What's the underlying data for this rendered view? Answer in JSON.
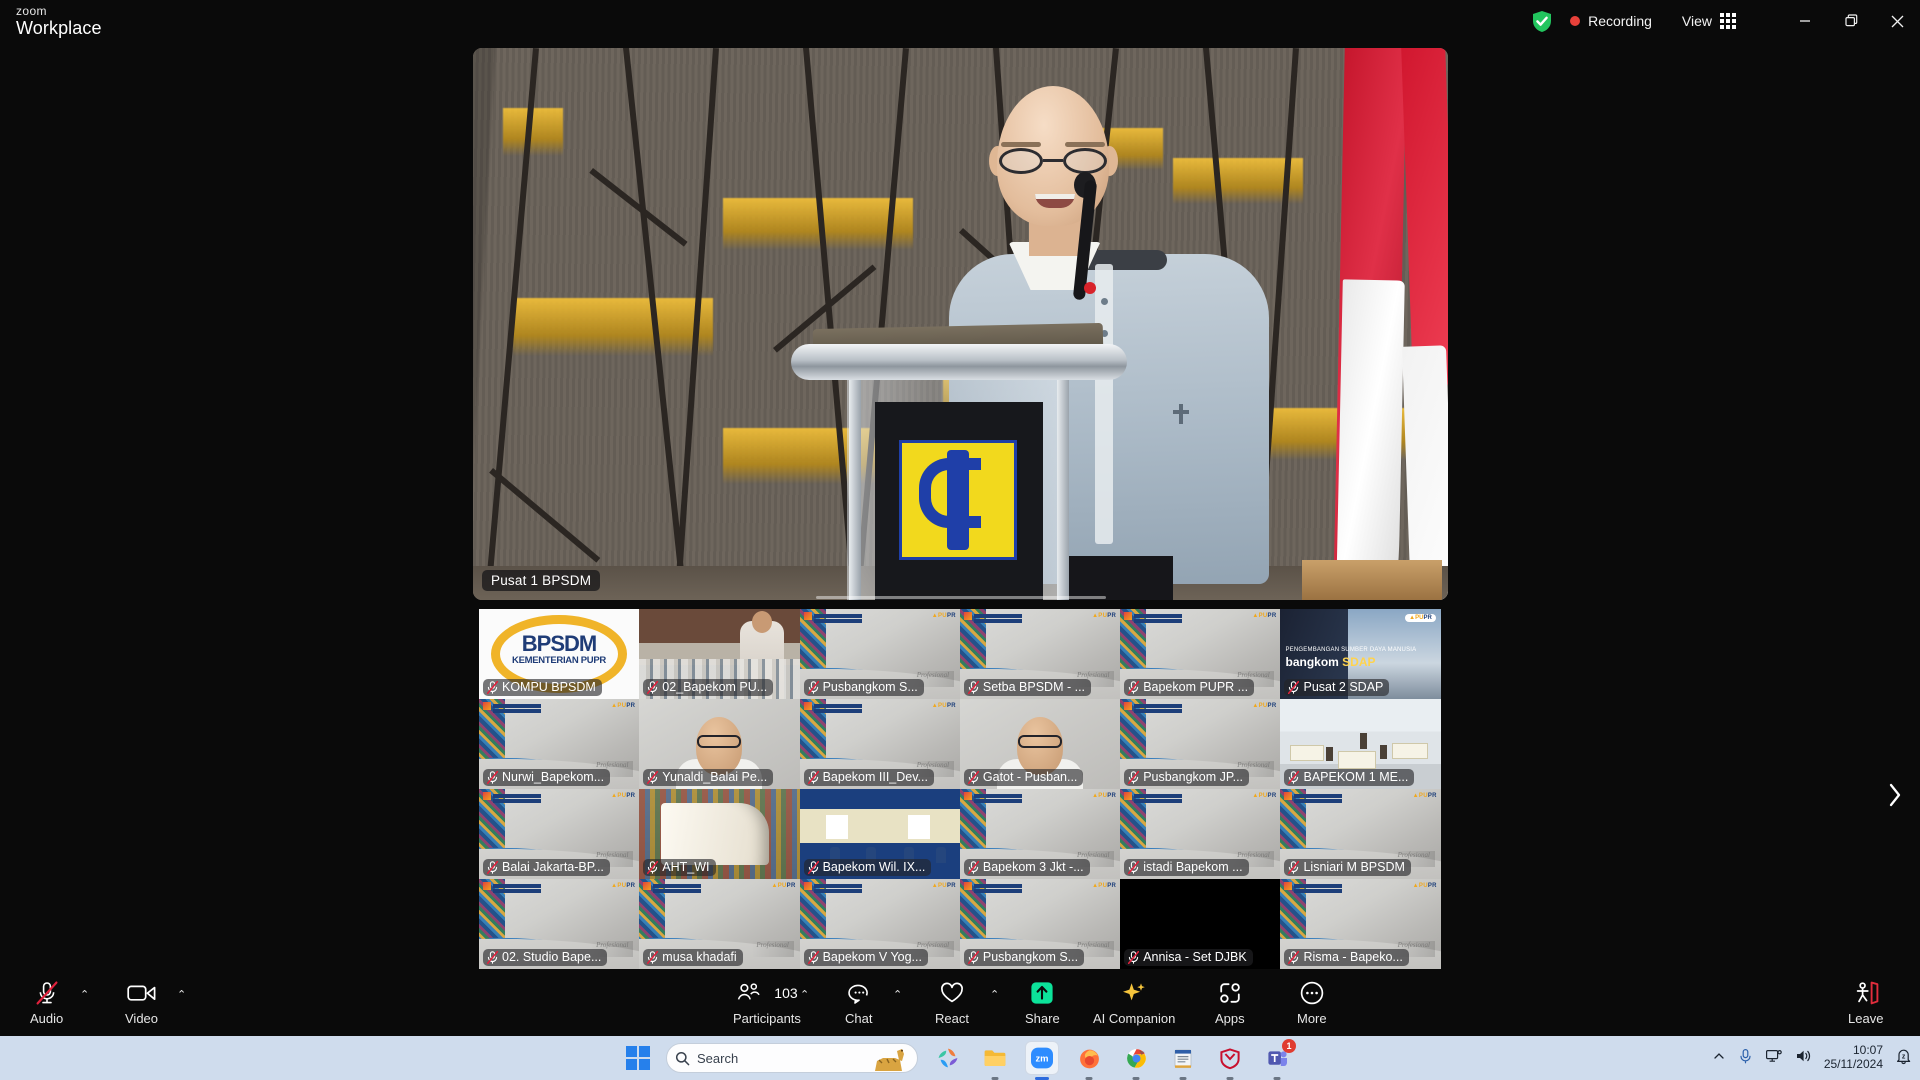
{
  "app": {
    "brand_top": "zoom",
    "brand_bottom": "Workplace"
  },
  "titlebar": {
    "security_icon": "shield-check-icon",
    "recording_label": "Recording",
    "view_label": "View",
    "view_icon": "grid-icon",
    "minimize_icon": "minimize-icon",
    "restore_icon": "restore-icon",
    "close_icon": "close-icon"
  },
  "stage": {
    "speaker_name": "Pusat 1 BPSDM"
  },
  "thumbnails": [
    {
      "label": "KOMPU BPSDM",
      "style": "ph-bpsdm",
      "muted": true,
      "selected": false
    },
    {
      "label": "02_Bapekom PU...",
      "style": "ph-hall",
      "muted": true,
      "selected": false
    },
    {
      "label": "Pusbangkom S...",
      "style": "vbg",
      "muted": true,
      "selected": false
    },
    {
      "label": "Setba BPSDM - ...",
      "style": "vbg",
      "muted": true,
      "selected": false
    },
    {
      "label": "Bapekom PUPR ...",
      "style": "vbg",
      "muted": true,
      "selected": false
    },
    {
      "label": "Pusat 2 SDAP",
      "style": "ph-sdap",
      "muted": true,
      "selected": false
    },
    {
      "label": "Nurwi_Bapekom...",
      "style": "vbg",
      "muted": true,
      "selected": false
    },
    {
      "label": "Yunaldi_Balai Pe...",
      "style": "ph-portrait",
      "muted": true,
      "selected": false
    },
    {
      "label": "Bapekom III_Dev...",
      "style": "vbg",
      "muted": true,
      "selected": false
    },
    {
      "label": "Gatot - Pusban...",
      "style": "ph-portrait",
      "muted": true,
      "selected": false
    },
    {
      "label": "Pusbangkom JP...",
      "style": "vbg",
      "muted": true,
      "selected": false
    },
    {
      "label": "BAPEKOM 1 ME...",
      "style": "ph-room",
      "muted": true,
      "selected": true
    },
    {
      "label": "Balai Jakarta-BP...",
      "style": "vbg",
      "muted": true,
      "selected": false
    },
    {
      "label": "AHT_WI",
      "style": "ph-books",
      "muted": true,
      "selected": false
    },
    {
      "label": "Bapekom Wil. IX...",
      "style": "ph-class",
      "muted": true,
      "selected": true
    },
    {
      "label": "Bapekom 3 Jkt -...",
      "style": "vbg",
      "muted": true,
      "selected": false
    },
    {
      "label": "istadi Bapekom ...",
      "style": "vbg",
      "muted": true,
      "selected": false
    },
    {
      "label": "Lisniari M BPSDM",
      "style": "vbg",
      "muted": true,
      "selected": false
    },
    {
      "label": "02. Studio Bape...",
      "style": "vbg",
      "muted": true,
      "selected": false
    },
    {
      "label": "musa khadafi",
      "style": "vbg",
      "muted": true,
      "selected": false
    },
    {
      "label": "Bapekom V Yog...",
      "style": "vbg",
      "muted": true,
      "selected": false
    },
    {
      "label": "Pusbangkom S...",
      "style": "vbg",
      "muted": true,
      "selected": false
    },
    {
      "label": "Annisa - Set DJBK",
      "style": "black",
      "muted": true,
      "selected": false
    },
    {
      "label": "Risma - Bapeko...",
      "style": "vbg",
      "muted": true,
      "selected": false
    }
  ],
  "gallery": {
    "next_page_icon": "chevron-right-icon"
  },
  "controls": {
    "audio": {
      "label": "Audio",
      "icon": "microphone-muted-icon",
      "has_caret": true
    },
    "video": {
      "label": "Video",
      "icon": "camera-icon",
      "has_caret": true
    },
    "participants": {
      "label": "Participants",
      "icon": "people-icon",
      "count": "103",
      "has_caret": true
    },
    "chat": {
      "label": "Chat",
      "icon": "chat-bubble-icon",
      "has_caret": true
    },
    "react": {
      "label": "React",
      "icon": "heart-icon",
      "has_caret": true
    },
    "share": {
      "label": "Share",
      "icon": "share-screen-icon",
      "has_caret": false
    },
    "ai": {
      "label": "AI Companion",
      "icon": "sparkle-icon",
      "has_caret": false
    },
    "apps": {
      "label": "Apps",
      "icon": "apps-icon",
      "has_caret": false
    },
    "more": {
      "label": "More",
      "icon": "ellipsis-icon",
      "has_caret": false
    },
    "leave": {
      "label": "Leave",
      "icon": "leave-door-icon",
      "has_caret": false
    }
  },
  "taskbar": {
    "start_icon": "windows-start-icon",
    "search_placeholder": "Search",
    "apps": [
      {
        "name": "copilot-icon",
        "running": false,
        "active": false,
        "badge": ""
      },
      {
        "name": "file-explorer-icon",
        "running": true,
        "active": false,
        "badge": ""
      },
      {
        "name": "zoom-icon",
        "running": true,
        "active": true,
        "badge": ""
      },
      {
        "name": "firefox-icon",
        "running": true,
        "active": false,
        "badge": ""
      },
      {
        "name": "chrome-icon",
        "running": true,
        "active": false,
        "badge": ""
      },
      {
        "name": "notepad-icon",
        "running": true,
        "active": false,
        "badge": ""
      },
      {
        "name": "mcafee-icon",
        "running": true,
        "active": false,
        "badge": ""
      },
      {
        "name": "teams-icon",
        "running": true,
        "active": false,
        "badge": "1"
      }
    ],
    "tray": {
      "overflow_icon": "chevron-up-icon",
      "mic_icon": "microphone-icon",
      "network_icon": "network-icon",
      "volume_icon": "speaker-icon",
      "time": "10:07",
      "date": "25/11/2024",
      "notification_icon": "notification-bell-icon"
    }
  },
  "colors": {
    "accent": "#2d8cff",
    "recording": "#e8413a",
    "share_green": "#0ce39a",
    "leave_red": "#e02d3c",
    "taskbar_bg": "#cfdced"
  }
}
